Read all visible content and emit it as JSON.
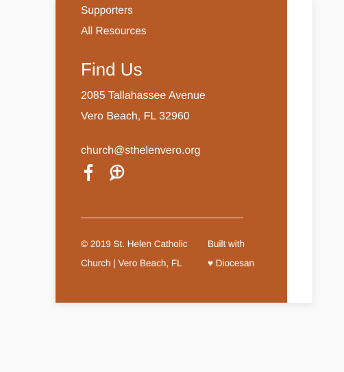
{
  "colors": {
    "footer_bg": "#b85a26",
    "card_bg": "#ffffff",
    "page_bg": "#f9f9f9",
    "text": "#ffffff"
  },
  "links": {
    "supporters": "Supporters",
    "all_resources": "All Resources"
  },
  "find_us": {
    "heading": "Find Us",
    "address_line1": "2085 Tallahassee Avenue",
    "address_line2": "Vero Beach, FL 32960",
    "email": "church@sthelenvero.org"
  },
  "social": {
    "icons": [
      "facebook-icon",
      "flocknote-icon"
    ]
  },
  "copyright": {
    "line1": "© 2019 St. Helen Catholic",
    "line2": "Church | Vero Beach, FL"
  },
  "built_with": {
    "line1": "Built with",
    "line2": "♥ Diocesan"
  }
}
